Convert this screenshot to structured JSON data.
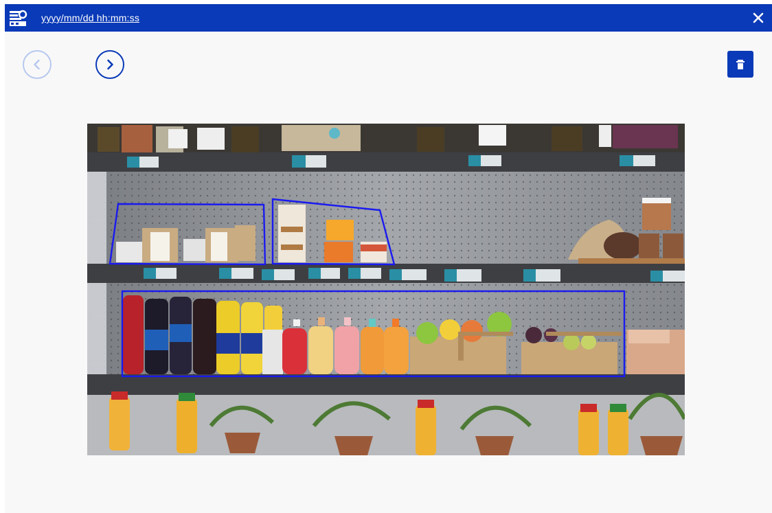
{
  "titlebar": {
    "timestamp": "yyyy/mm/dd hh:mm:ss",
    "logo_icon": "app-logo-icon",
    "close_icon": "close-icon"
  },
  "toolbar": {
    "prev_icon": "chevron-left-icon",
    "next_icon": "chevron-right-icon",
    "delete_icon": "trash-icon"
  },
  "colors": {
    "accent": "#0a3ab7",
    "disabled": "#b7c8ef",
    "annotation_stroke": "#1a1af0"
  },
  "annotations": [
    {
      "label": ""
    },
    {
      "label": ""
    },
    {
      "label": ""
    }
  ]
}
